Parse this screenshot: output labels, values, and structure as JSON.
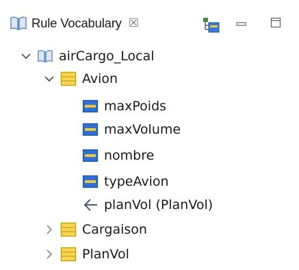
{
  "view": {
    "tab_title": "Rule Vocabulary",
    "tab_close_glyph": "☒",
    "icons": {
      "tab_icon": "book-icon",
      "toolbar": [
        "new-term-icon",
        "minimize-icon",
        "maximize-icon"
      ]
    }
  },
  "tree": [
    {
      "label": "airCargo_Local",
      "icon": "book-icon",
      "expanded": true
    },
    {
      "label": "Avion",
      "icon": "class-icon",
      "expanded": true
    },
    {
      "label": "maxPoids",
      "icon": "attribute-icon"
    },
    {
      "label": "maxVolume",
      "icon": "attribute-icon"
    },
    {
      "label": "nombre",
      "icon": "attribute-icon"
    },
    {
      "label": "typeAvion",
      "icon": "attribute-icon"
    },
    {
      "label": "planVol (PlanVol)",
      "icon": "association-icon"
    },
    {
      "label": "Cargaison",
      "icon": "class-icon",
      "expanded": false
    },
    {
      "label": "PlanVol",
      "icon": "class-icon",
      "expanded": false
    }
  ],
  "colors": {
    "class_fill": "#f7d656",
    "class_stroke": "#c8a20c",
    "attr_fill": "#2f6fd6",
    "attr_stripe": "#f0c93a",
    "book_blue": "#6b8fc2",
    "chevron": "#555555"
  }
}
